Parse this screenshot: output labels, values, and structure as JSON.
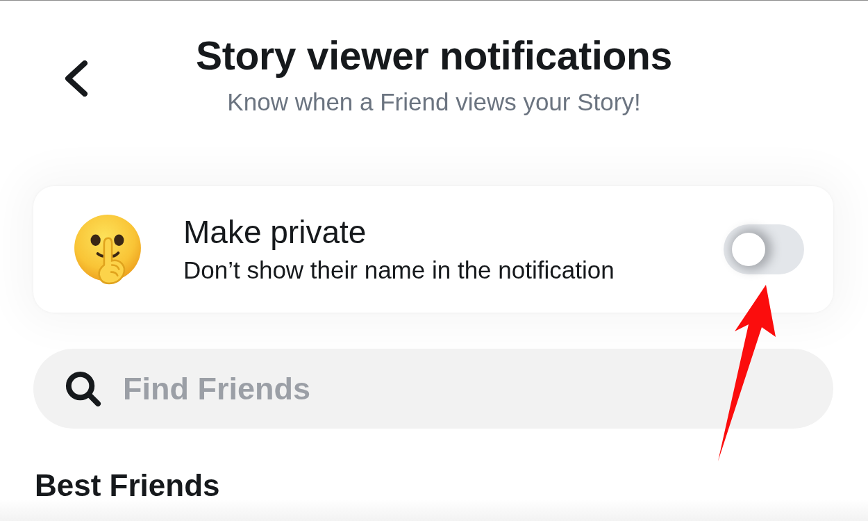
{
  "header": {
    "title": "Story viewer notifications",
    "subtitle": "Know when a Friend views your Story!"
  },
  "privacy_setting": {
    "label": "Make private",
    "description": "Don’t show their name in the notification",
    "on": false
  },
  "search": {
    "placeholder": "Find Friends"
  },
  "sections": [
    {
      "heading": "Best Friends"
    }
  ]
}
